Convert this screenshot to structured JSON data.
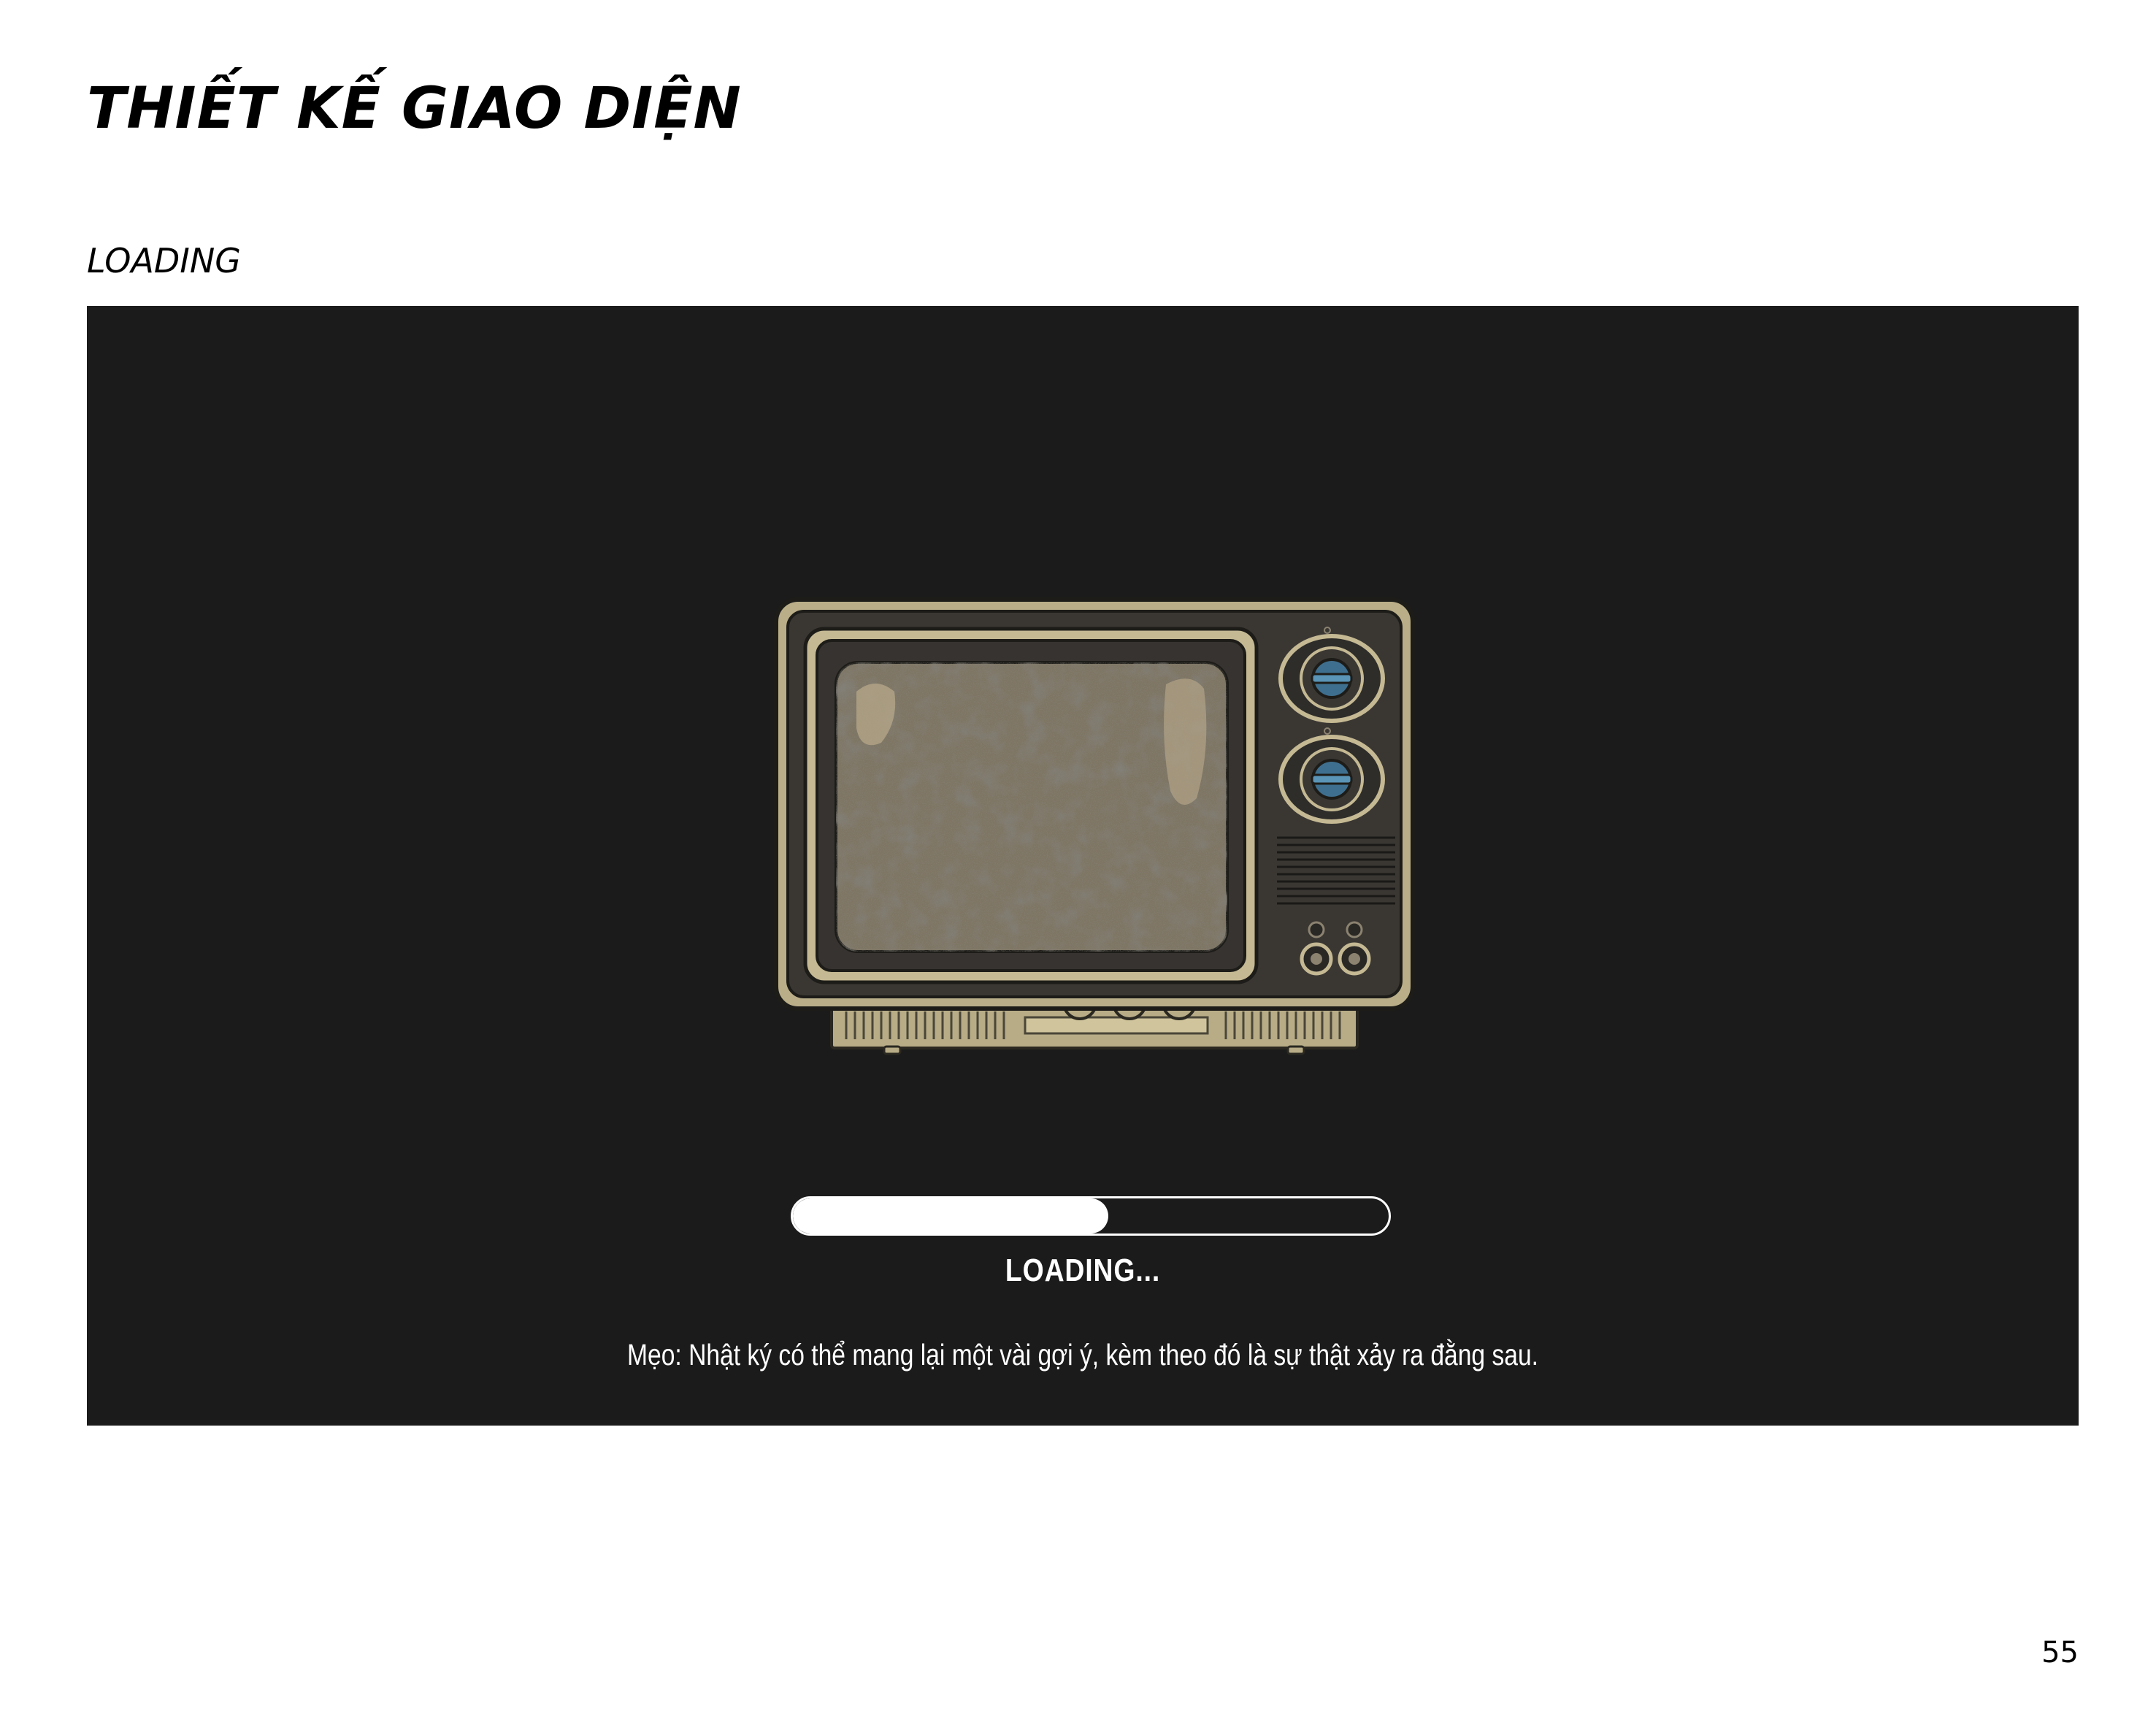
{
  "page": {
    "title": "THIẾT KẾ GIAO DIỆN",
    "section_label": "LOADING",
    "page_number": "55"
  },
  "loading_screen": {
    "background_color": "#1b1b1b",
    "illustration": "retro-tv-icon",
    "progress_fraction": 0.53,
    "status_text": "LOADING...",
    "tip_text": "Mẹo: Nhật ký có thể mang lại một vài gợi ý, kèm theo đó là sự thật xảy ra đằng sau."
  }
}
